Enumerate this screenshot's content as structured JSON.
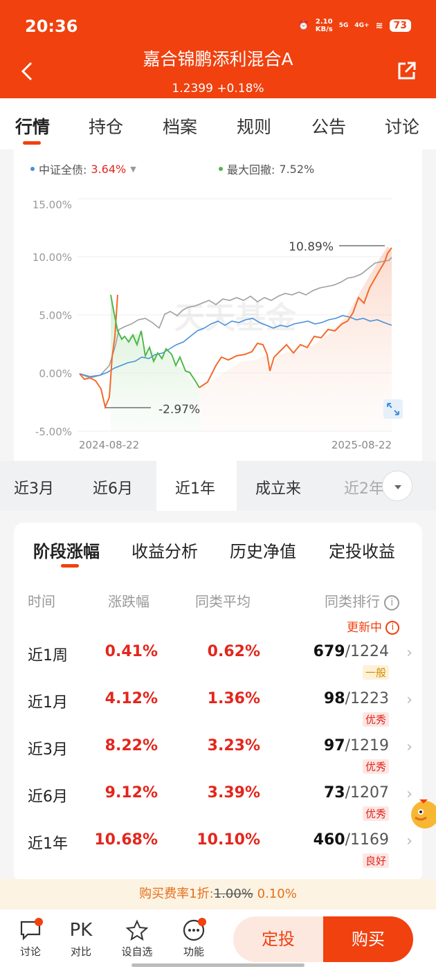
{
  "status_bar": {
    "time": "20:36",
    "speed_value": "2.10",
    "speed_unit": "KB/s",
    "net1": "5G",
    "net2": "4G+",
    "battery": "73"
  },
  "header": {
    "title": "嘉合锦鹏添利混合A",
    "nav": "1.2399",
    "change": "+0.18%"
  },
  "tabs": [
    "行情",
    "持仓",
    "档案",
    "规则",
    "公告",
    "讨论"
  ],
  "chart": {
    "legend_index_label": "中证全债:",
    "legend_index_value": "3.64%",
    "legend_drawdown_label": "最大回撤:",
    "legend_drawdown_value": "7.52%",
    "watermark": "天天基金",
    "colors": {
      "fund": "#f26a2b",
      "index": "#4a90d9",
      "peer": "#9e9e9e",
      "drawdown": "#4cb848"
    }
  },
  "chart_data": {
    "type": "line",
    "x_start": "2024-08-22",
    "x_end": "2025-08-22",
    "yticks": [
      "15.00%",
      "10.00%",
      "5.00%",
      "0.00%",
      "-5.00%"
    ],
    "ylim": [
      -5,
      15
    ],
    "annotations": [
      {
        "label": "10.89%"
      },
      {
        "label": "-2.97%"
      }
    ]
  },
  "periods": [
    "近3月",
    "近6月",
    "近1年",
    "成立来",
    "近2年"
  ],
  "performance": {
    "tabs": [
      "阶段涨幅",
      "收益分析",
      "历史净值",
      "定投收益"
    ],
    "headers": {
      "time": "时间",
      "change": "涨跌幅",
      "avg": "同类平均",
      "rank": "同类排行"
    },
    "updating": "更新中",
    "rows": [
      {
        "period": "近1周",
        "change": "0.41%",
        "avg": "0.62%",
        "rank": "679",
        "total": "/1224",
        "level": "一般"
      },
      {
        "period": "近1月",
        "change": "4.12%",
        "avg": "1.36%",
        "rank": "98",
        "total": "/1223",
        "level": "优秀"
      },
      {
        "period": "近3月",
        "change": "8.22%",
        "avg": "3.23%",
        "rank": "97",
        "total": "/1219",
        "level": "优秀"
      },
      {
        "period": "近6月",
        "change": "9.12%",
        "avg": "3.39%",
        "rank": "73",
        "total": "/1207",
        "level": "优秀"
      },
      {
        "period": "近1年",
        "change": "10.68%",
        "avg": "10.10%",
        "rank": "460",
        "total": "/1169",
        "level": "良好"
      }
    ]
  },
  "fee": {
    "text": "购买费率1折:",
    "old": "1.00%",
    "new": "0.10%"
  },
  "bottom_nav": {
    "items": [
      {
        "icon": "chat-icon",
        "label": "讨论"
      },
      {
        "icon_text": "PK",
        "label": "对比"
      },
      {
        "icon": "star-icon",
        "label": "设自选"
      },
      {
        "icon": "more-icon",
        "label": "功能"
      }
    ],
    "sip": "定投",
    "buy": "购买"
  }
}
